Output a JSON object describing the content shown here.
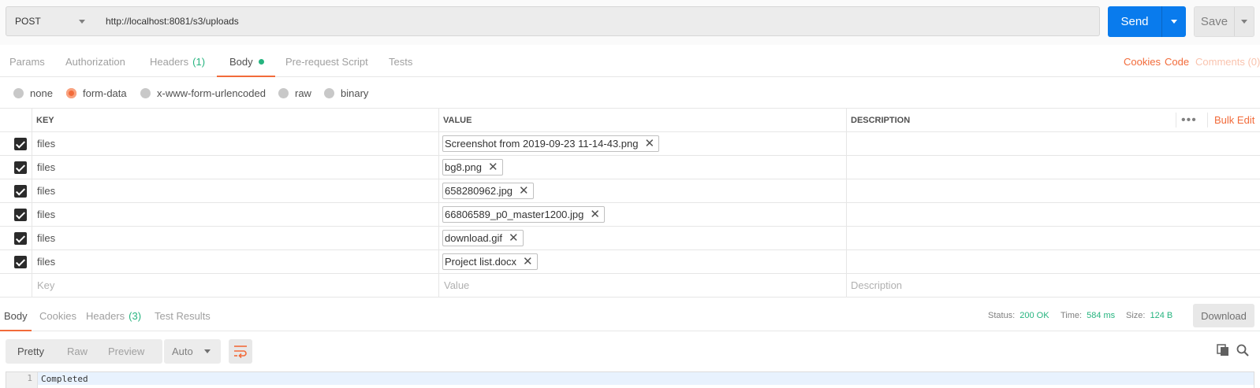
{
  "request": {
    "method": "POST",
    "url": "http://localhost:8081/s3/uploads",
    "send_label": "Send",
    "save_label": "Save"
  },
  "request_tabs": [
    {
      "label": "Params"
    },
    {
      "label": "Authorization"
    },
    {
      "label": "Headers",
      "count": "(1)"
    },
    {
      "label": "Body"
    },
    {
      "label": "Pre-request Script"
    },
    {
      "label": "Tests"
    }
  ],
  "request_links": {
    "cookies": "Cookies",
    "code": "Code",
    "comments": "Comments (0)"
  },
  "body_types": [
    {
      "label": "none",
      "selected": false
    },
    {
      "label": "form-data",
      "selected": true
    },
    {
      "label": "x-www-form-urlencoded",
      "selected": false
    },
    {
      "label": "raw",
      "selected": false
    },
    {
      "label": "binary",
      "selected": false
    }
  ],
  "table": {
    "headers": {
      "key": "KEY",
      "value": "VALUE",
      "description": "DESCRIPTION"
    },
    "more_label": "•••",
    "bulk_edit_label": "Bulk Edit",
    "rows": [
      {
        "checked": true,
        "key": "files",
        "value": "Screenshot from 2019-09-23 11-14-43.png",
        "description": ""
      },
      {
        "checked": true,
        "key": "files",
        "value": "bg8.png",
        "description": ""
      },
      {
        "checked": true,
        "key": "files",
        "value": "658280962.jpg",
        "description": ""
      },
      {
        "checked": true,
        "key": "files",
        "value": "66806589_p0_master1200.jpg",
        "description": ""
      },
      {
        "checked": true,
        "key": "files",
        "value": "download.gif",
        "description": ""
      },
      {
        "checked": true,
        "key": "files",
        "value": "Project list.docx",
        "description": ""
      }
    ],
    "placeholders": {
      "key": "Key",
      "value": "Value",
      "description": "Description"
    }
  },
  "response_tabs": [
    {
      "label": "Body"
    },
    {
      "label": "Cookies"
    },
    {
      "label": "Headers",
      "count": "(3)"
    },
    {
      "label": "Test Results"
    }
  ],
  "response_status": {
    "status_label": "Status:",
    "status_value": "200 OK",
    "time_label": "Time:",
    "time_value": "584 ms",
    "size_label": "Size:",
    "size_value": "124 B",
    "download_label": "Download"
  },
  "response_view": {
    "modes": [
      "Pretty",
      "Raw",
      "Preview"
    ],
    "format": "Auto"
  },
  "response_body": [
    {
      "line": "1",
      "text": "Completed"
    }
  ],
  "colors": {
    "accent": "#f26b3a",
    "send": "#097bed",
    "success": "#26b47f"
  }
}
